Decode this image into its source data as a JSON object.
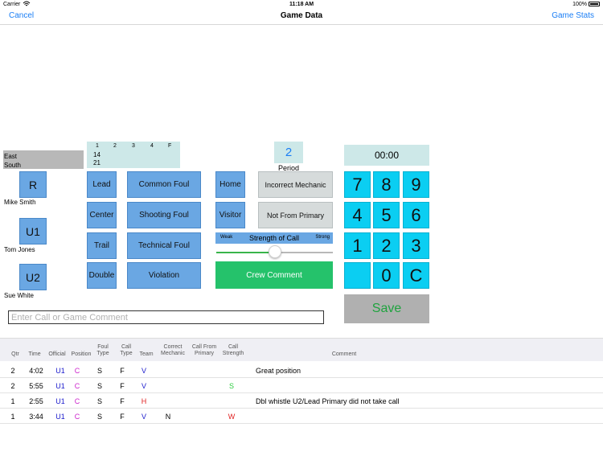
{
  "status_bar": {
    "carrier": "Carrier",
    "time": "11:18 AM",
    "battery": "100%"
  },
  "nav": {
    "cancel": "Cancel",
    "title": "Game Data",
    "game_stats": "Game Stats"
  },
  "scoreboard": {
    "teams": [
      "East",
      "South"
    ]
  },
  "quarters": {
    "headers": [
      "1",
      "2",
      "3",
      "4",
      "F"
    ],
    "rows": [
      "14",
      "21"
    ]
  },
  "officials": [
    {
      "code": "R",
      "name": "Mike Smith"
    },
    {
      "code": "U1",
      "name": "Tom Jones"
    },
    {
      "code": "U2",
      "name": "Sue White"
    }
  ],
  "positions": [
    "Lead",
    "Center",
    "Trail",
    "Double"
  ],
  "foul_types": [
    "Common Foul",
    "Shooting Foul",
    "Technical Foul",
    "Violation"
  ],
  "team_buttons": [
    "Home",
    "Visitor"
  ],
  "mechanic_buttons": [
    "Incorrect Mechanic",
    "Not From Primary"
  ],
  "period": {
    "value": "2",
    "label": "Period"
  },
  "strength": {
    "weak": "Weak",
    "label": "Strength of Call",
    "strong": "Strong",
    "level": 0.5
  },
  "crew_comment": "Crew Comment",
  "timer": "00:00",
  "keypad": [
    "7",
    "8",
    "9",
    "4",
    "5",
    "6",
    "1",
    "2",
    "3",
    "",
    "0",
    "C"
  ],
  "save": "Save",
  "comment_placeholder": "Enter Call or Game Comment",
  "table": {
    "headers": [
      "Qtr",
      "Time",
      "Official",
      "Position",
      "Foul Type",
      "Call Type",
      "Team",
      "Correct Mechanic",
      "Call From Primary",
      "Call Strength",
      "Comment"
    ],
    "rows": [
      {
        "qtr": "2",
        "time": "4:02",
        "official": "U1",
        "position": "C",
        "foul": "S",
        "call": "F",
        "team": "V",
        "mechanic": "",
        "primary": "",
        "strength": "",
        "comment": "Great position"
      },
      {
        "qtr": "2",
        "time": "5:55",
        "official": "U1",
        "position": "C",
        "foul": "S",
        "call": "F",
        "team": "V",
        "mechanic": "",
        "primary": "",
        "strength": "S",
        "comment": ""
      },
      {
        "qtr": "1",
        "time": "2:55",
        "official": "U1",
        "position": "C",
        "foul": "S",
        "call": "F",
        "team": "H",
        "mechanic": "",
        "primary": "",
        "strength": "",
        "comment": "Dbl whistle U2/Lead Primary did not take call"
      },
      {
        "qtr": "1",
        "time": "3:44",
        "official": "U1",
        "position": "C",
        "foul": "S",
        "call": "F",
        "team": "V",
        "mechanic": "N",
        "primary": "",
        "strength": "W",
        "comment": ""
      }
    ]
  },
  "colors": {
    "official": "#1a1acc",
    "position": "#cc22cc",
    "team_visitor": "#1a1acc",
    "team_home": "#e02020",
    "strength_strong": "#2ecc40",
    "strength_weak": "#e02020"
  }
}
